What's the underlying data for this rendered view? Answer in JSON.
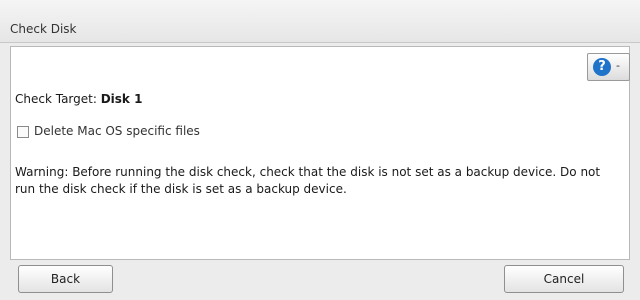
{
  "window": {
    "title": "Check Disk"
  },
  "help": {
    "icon": "question-mark-icon",
    "symbol": "?",
    "caret": "-"
  },
  "target": {
    "label": "Check Target: ",
    "value": "Disk 1"
  },
  "checkbox": {
    "label": "Delete Mac OS specific files",
    "checked": false
  },
  "warning": {
    "text": "Warning: Before running the disk check, check that the disk is not set as a backup device. Do not run the disk check if the disk is set as a backup device."
  },
  "buttons": {
    "back": "Back",
    "cancel": "Cancel"
  }
}
